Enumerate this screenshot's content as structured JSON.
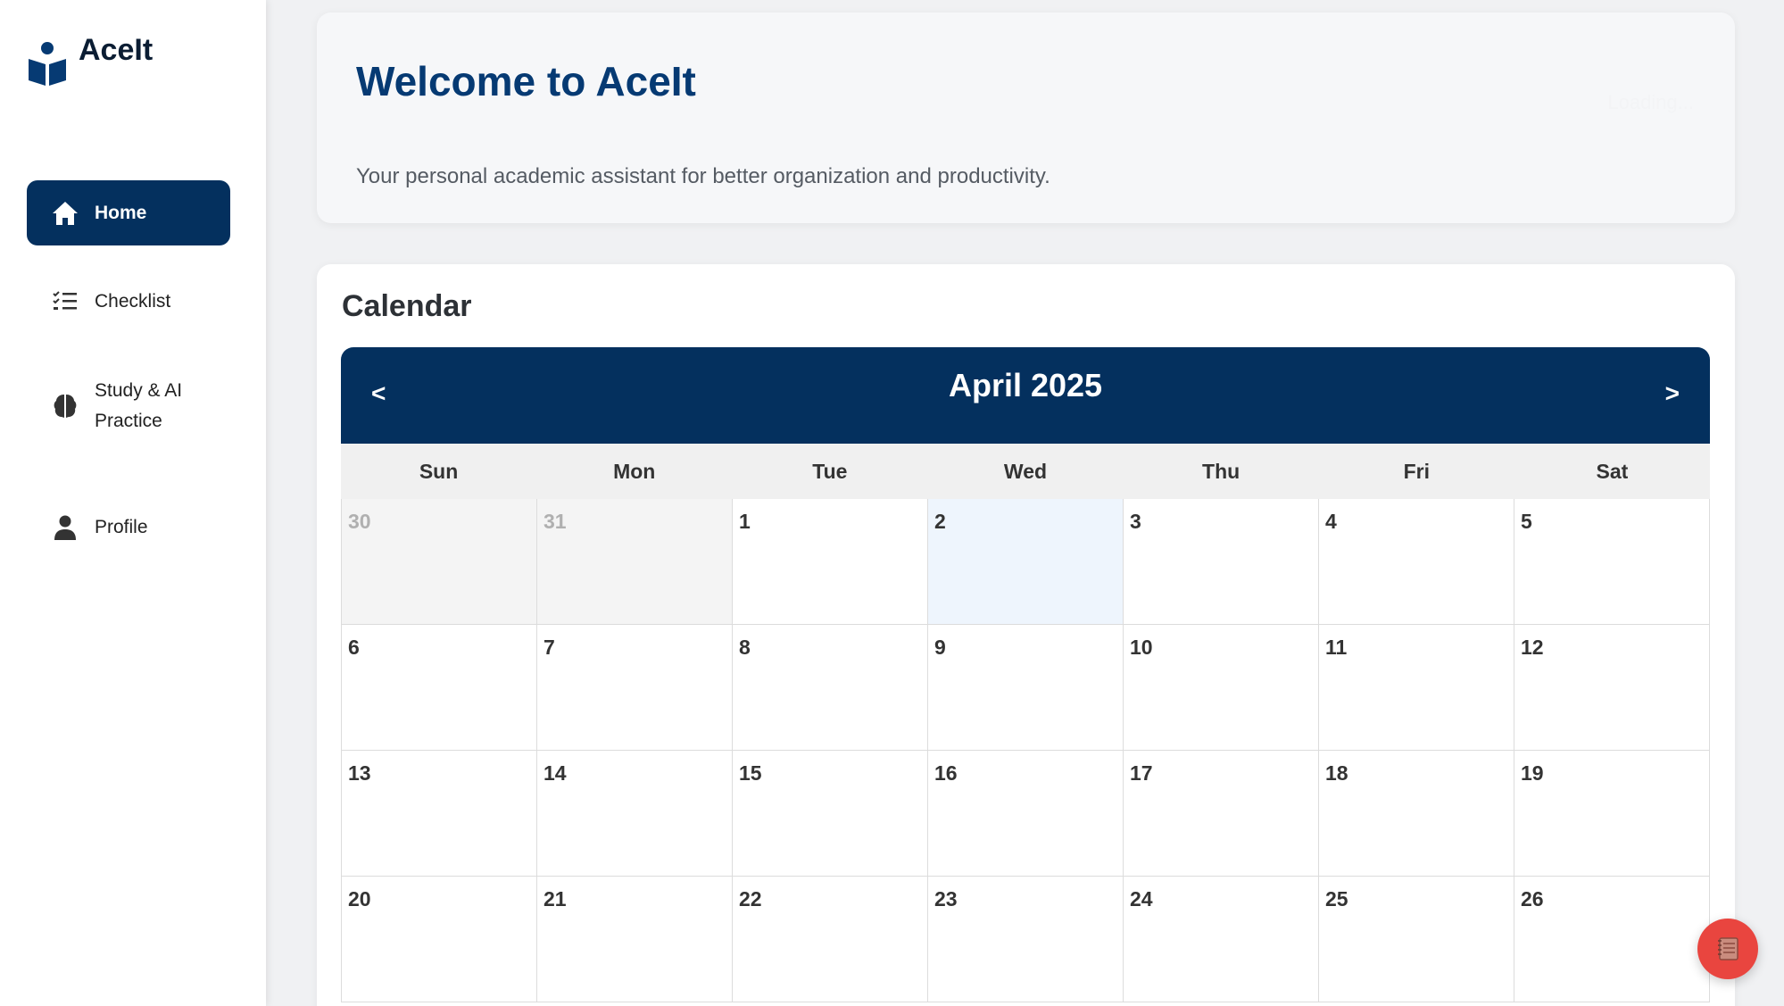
{
  "brand": {
    "name": "AceIt",
    "logo_icon": "book-reader-icon"
  },
  "sidebar": {
    "items": [
      {
        "label": "Home",
        "icon": "home-icon",
        "active": true
      },
      {
        "label": "Checklist",
        "icon": "checklist-icon"
      },
      {
        "label": "Study & AI Practice",
        "icon": "brain-icon"
      },
      {
        "label": "Profile",
        "icon": "user-icon"
      }
    ]
  },
  "welcome": {
    "title": "Welcome to AceIt",
    "loading": "Loading...",
    "subtitle": "Your personal academic assistant for better organization and productivity."
  },
  "calendar": {
    "title": "Calendar",
    "month_label": "April 2025",
    "prev_label": "<",
    "next_label": ">",
    "weekdays": [
      "Sun",
      "Mon",
      "Tue",
      "Wed",
      "Thu",
      "Fri",
      "Sat"
    ],
    "days": [
      {
        "n": "30",
        "other": true
      },
      {
        "n": "31",
        "other": true
      },
      {
        "n": "1"
      },
      {
        "n": "2",
        "today": true
      },
      {
        "n": "3"
      },
      {
        "n": "4"
      },
      {
        "n": "5"
      },
      {
        "n": "6"
      },
      {
        "n": "7"
      },
      {
        "n": "8"
      },
      {
        "n": "9"
      },
      {
        "n": "10"
      },
      {
        "n": "11"
      },
      {
        "n": "12"
      },
      {
        "n": "13"
      },
      {
        "n": "14"
      },
      {
        "n": "15"
      },
      {
        "n": "16"
      },
      {
        "n": "17"
      },
      {
        "n": "18"
      },
      {
        "n": "19"
      },
      {
        "n": "20"
      },
      {
        "n": "21"
      },
      {
        "n": "22"
      },
      {
        "n": "23"
      },
      {
        "n": "24"
      },
      {
        "n": "25"
      },
      {
        "n": "26"
      }
    ]
  },
  "fab": {
    "icon": "notebook-icon"
  },
  "colors": {
    "primary": "#04305e",
    "title": "#063a73",
    "fab": "#e9453f",
    "today": "#eef5fd"
  }
}
